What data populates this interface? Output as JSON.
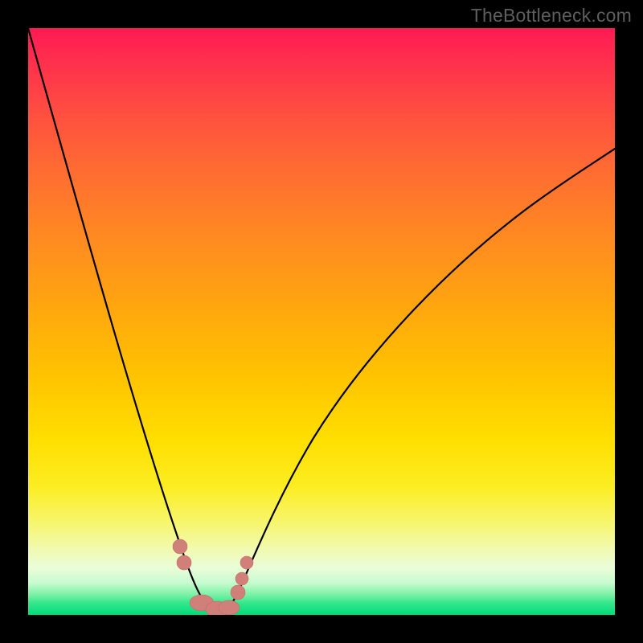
{
  "watermark": {
    "text": "TheBottleneck.com"
  },
  "chart_data": {
    "type": "line",
    "title": "",
    "xlabel": "",
    "ylabel": "",
    "xlim": [
      0,
      1
    ],
    "ylim": [
      0,
      1
    ],
    "background_gradient": {
      "orientation": "vertical",
      "stops": [
        {
          "pos": 0.0,
          "color": "#ff1a53"
        },
        {
          "pos": 0.5,
          "color": "#ffc500"
        },
        {
          "pos": 0.85,
          "color": "#f5f98a"
        },
        {
          "pos": 1.0,
          "color": "#00dd7a"
        }
      ]
    },
    "series": [
      {
        "name": "bottleneck-curve",
        "color": "#000000",
        "x": [
          0.0,
          0.033,
          0.067,
          0.1,
          0.133,
          0.167,
          0.2,
          0.233,
          0.258,
          0.275,
          0.29,
          0.3,
          0.31,
          0.32,
          0.33,
          0.345,
          0.36,
          0.38,
          0.4,
          0.43,
          0.467,
          0.5,
          0.55,
          0.6,
          0.667,
          0.733,
          0.8,
          0.867,
          0.933,
          1.0
        ],
        "y": [
          1.0,
          0.88,
          0.76,
          0.64,
          0.52,
          0.4,
          0.28,
          0.16,
          0.08,
          0.04,
          0.015,
          0.005,
          0.0,
          0.0,
          0.003,
          0.015,
          0.04,
          0.085,
          0.14,
          0.21,
          0.285,
          0.345,
          0.42,
          0.485,
          0.56,
          0.625,
          0.68,
          0.725,
          0.765,
          0.8
        ]
      },
      {
        "name": "bottleneck-markers",
        "color": "#d08079",
        "marker": "circle",
        "x": [
          0.255,
          0.262,
          0.29,
          0.31,
          0.33,
          0.35,
          0.358,
          0.368
        ],
        "y": [
          0.085,
          0.06,
          0.01,
          0.003,
          0.003,
          0.015,
          0.04,
          0.075
        ]
      }
    ]
  }
}
